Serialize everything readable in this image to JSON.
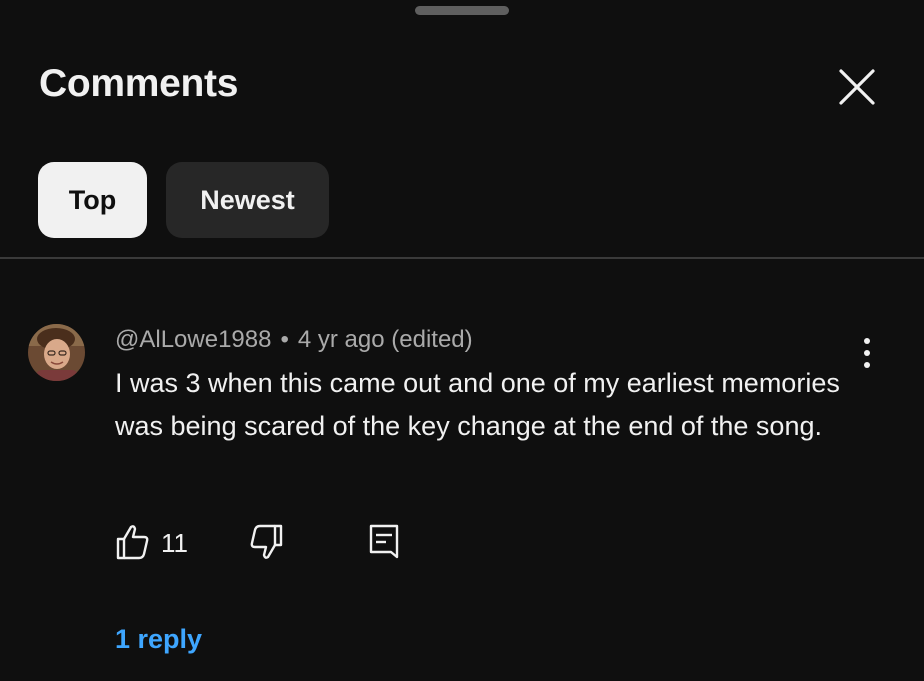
{
  "header": {
    "title": "Comments"
  },
  "filters": {
    "items": [
      {
        "label": "Top",
        "active": true
      },
      {
        "label": "Newest",
        "active": false
      }
    ]
  },
  "comment": {
    "author": "@AlLowe1988",
    "separator": "•",
    "timestamp": "4 yr ago (edited)",
    "text": "I was 3 when this came out and one of my earliest memories was being scared of the key change at the end of the song.",
    "like_count": "11",
    "reply_link": "1 reply"
  },
  "icons": {
    "close": "close-icon",
    "more": "more-vert-icon",
    "like": "thumbs-up-icon",
    "dislike": "thumbs-down-icon",
    "reply": "comment-icon"
  },
  "colors": {
    "background": "#0f0f0f",
    "chip_active_bg": "#f1f1f1",
    "chip_inactive_bg": "#272727",
    "link": "#3ea6ff",
    "secondary_text": "#aaaaaa"
  }
}
